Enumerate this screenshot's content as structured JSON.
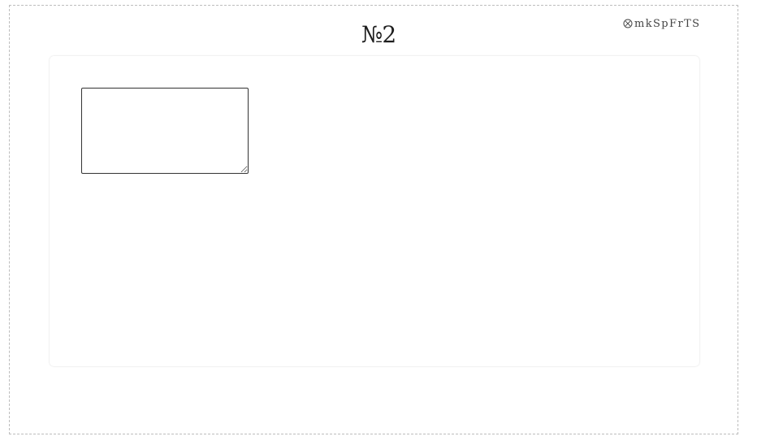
{
  "page": {
    "title": "№2"
  },
  "corner": {
    "icon": "circled-x-icon",
    "label": "mkSpFrTS"
  },
  "panel": {
    "textarea": {
      "value": "",
      "placeholder": ""
    }
  }
}
